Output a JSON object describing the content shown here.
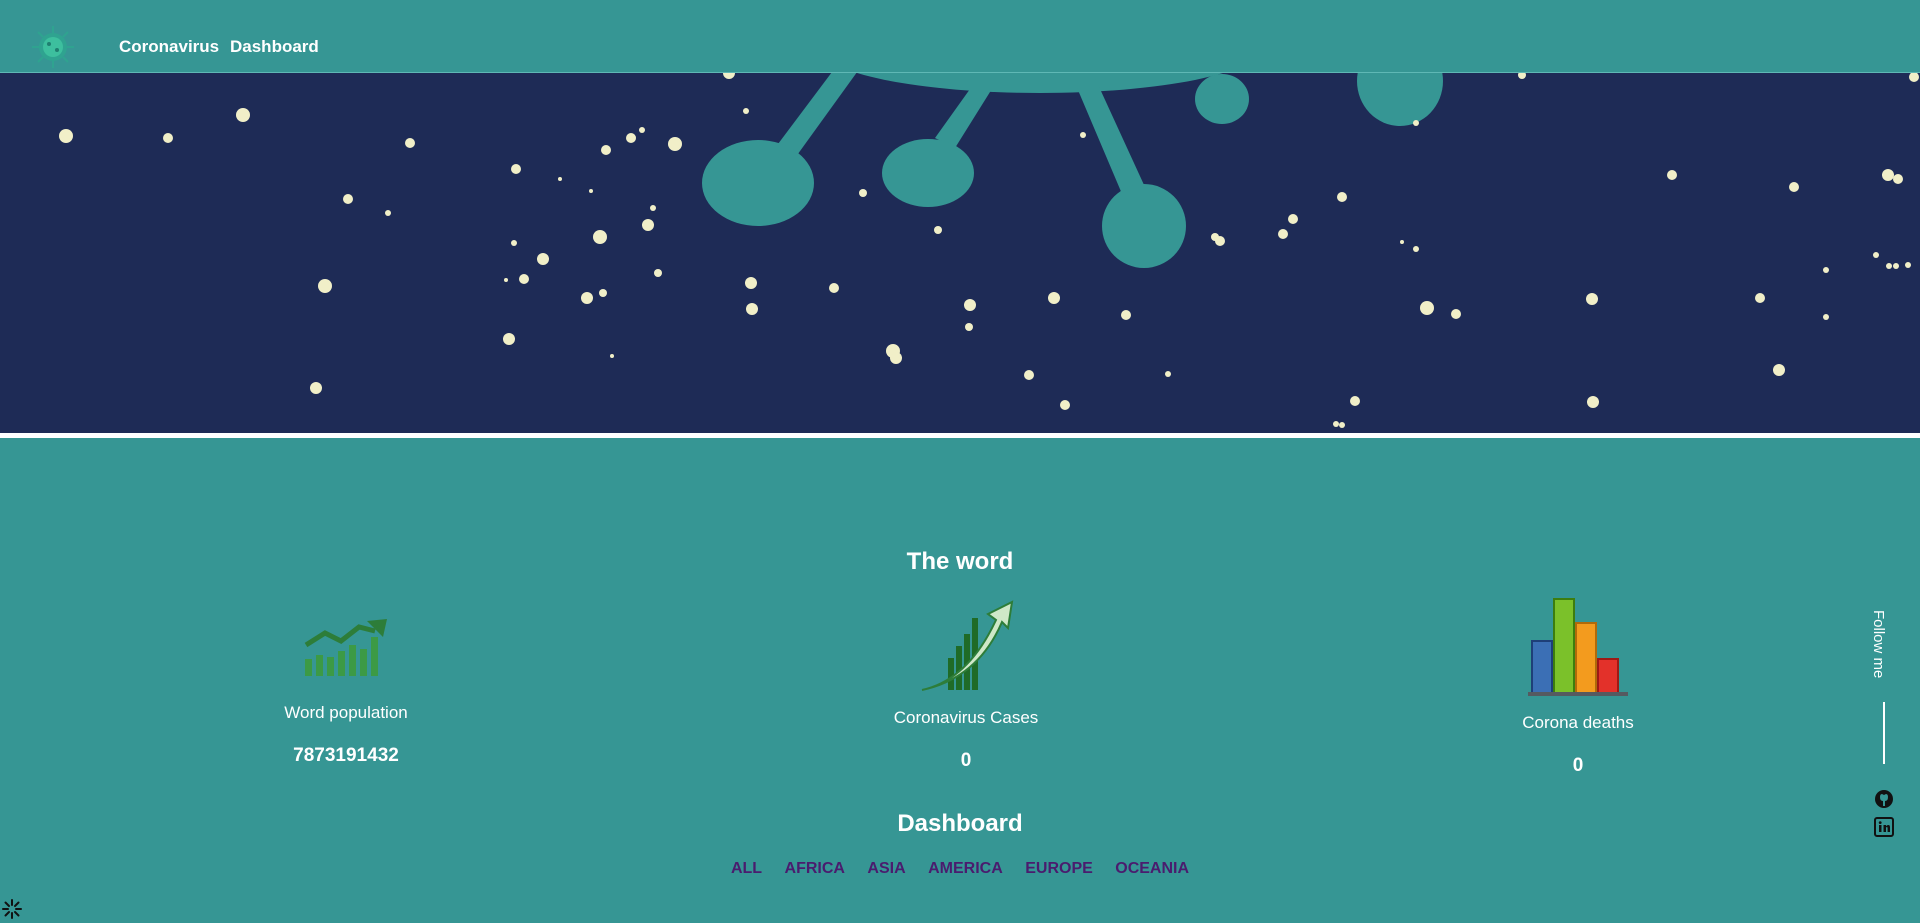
{
  "nav": {
    "logo_icon": "virus-icon",
    "links": [
      "Coronavirus",
      "Dashboard"
    ]
  },
  "stats_section": {
    "title": "The word",
    "items": [
      {
        "label": "Word population",
        "value": "7873191432",
        "icon": "trend-chart-icon"
      },
      {
        "label": "Coronavirus Cases",
        "value": "0",
        "icon": "rising-arrow-icon"
      },
      {
        "label": "Corona deaths",
        "value": "0",
        "icon": "bar-chart-icon"
      }
    ]
  },
  "dashboard": {
    "title": "Dashboard",
    "filters": [
      "ALL",
      "AFRICA",
      "ASIA",
      "AMERICA",
      "EUROPE",
      "OCEANIA"
    ]
  },
  "sidebar": {
    "follow_text": "Follow me",
    "icons": [
      "github-icon",
      "linkedin-icon"
    ]
  },
  "colors": {
    "background": "#369694",
    "hero": "#1e2b56",
    "filter_text": "#4a1c6e"
  }
}
